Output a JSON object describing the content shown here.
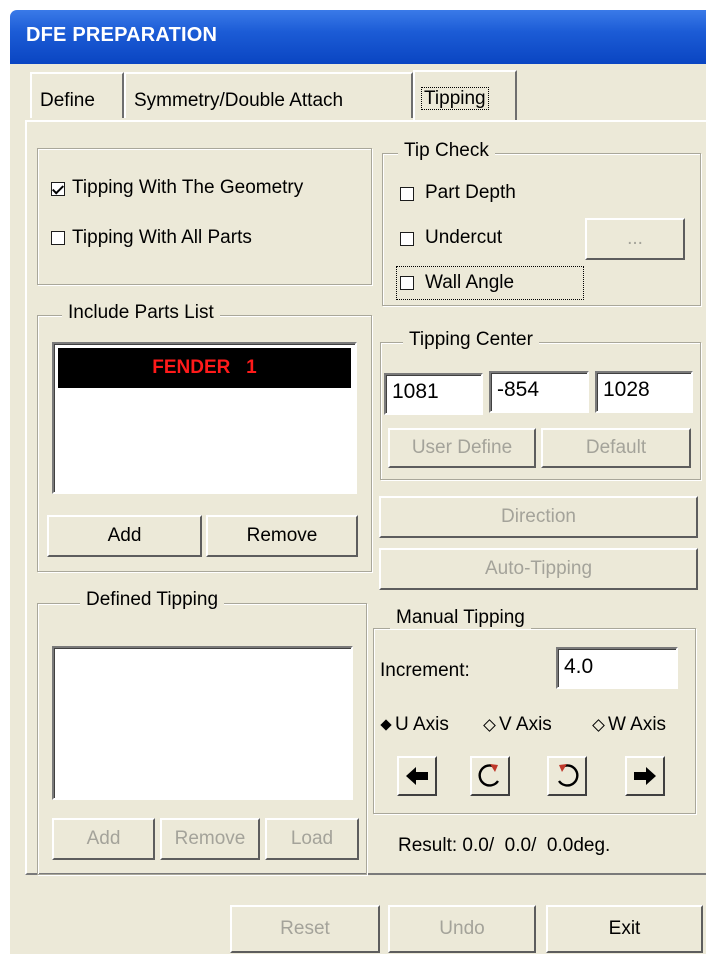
{
  "window": {
    "title": "DFE PREPARATION"
  },
  "tabs": [
    {
      "label": "Define"
    },
    {
      "label": "Symmetry/Double Attach"
    },
    {
      "label": "Tipping"
    }
  ],
  "tipping_options": {
    "with_geometry": {
      "label": "Tipping With The Geometry",
      "checked": true
    },
    "with_all_parts": {
      "label": "Tipping With All Parts",
      "checked": false
    }
  },
  "tip_check": {
    "title": "Tip Check",
    "part_depth": {
      "label": "Part Depth",
      "checked": false
    },
    "undercut": {
      "label": "Undercut",
      "checked": false
    },
    "undercut_button": "...",
    "wall_angle": {
      "label": "Wall Angle",
      "checked": false
    }
  },
  "include_parts": {
    "title": "Include Parts List",
    "items": [
      "FENDER   1"
    ],
    "add_label": "Add",
    "remove_label": "Remove"
  },
  "tipping_center": {
    "title": "Tipping Center",
    "x": "1081",
    "y": "-854",
    "z": "1028",
    "user_define_label": "User Define",
    "default_label": "Default"
  },
  "direction_label": "Direction",
  "auto_tipping_label": "Auto-Tipping",
  "defined_tipping": {
    "title": "Defined Tipping",
    "items": [],
    "add_label": "Add",
    "remove_label": "Remove",
    "load_label": "Load"
  },
  "manual_tipping": {
    "title": "Manual Tipping",
    "increment_label": "Increment:",
    "increment_value": "4.0",
    "axes": [
      {
        "label": "U Axis",
        "selected": true
      },
      {
        "label": "V Axis",
        "selected": false
      },
      {
        "label": "W Axis",
        "selected": false
      }
    ],
    "buttons": [
      "arrow-left-icon",
      "rotate-clockwise-icon",
      "rotate-counterclockwise-icon",
      "arrow-right-icon"
    ]
  },
  "result": {
    "label": "Result:",
    "value": "0.0/  0.0/  0.0deg."
  },
  "bottom": {
    "reset_label": "Reset",
    "undo_label": "Undo",
    "exit_label": "Exit"
  },
  "colors": {
    "titlebar": "#1c5cd6",
    "face": "#ece9d8",
    "selection": "#000000",
    "selection_text": "#ff1a1a",
    "disabled_text": "#a4a39a"
  }
}
